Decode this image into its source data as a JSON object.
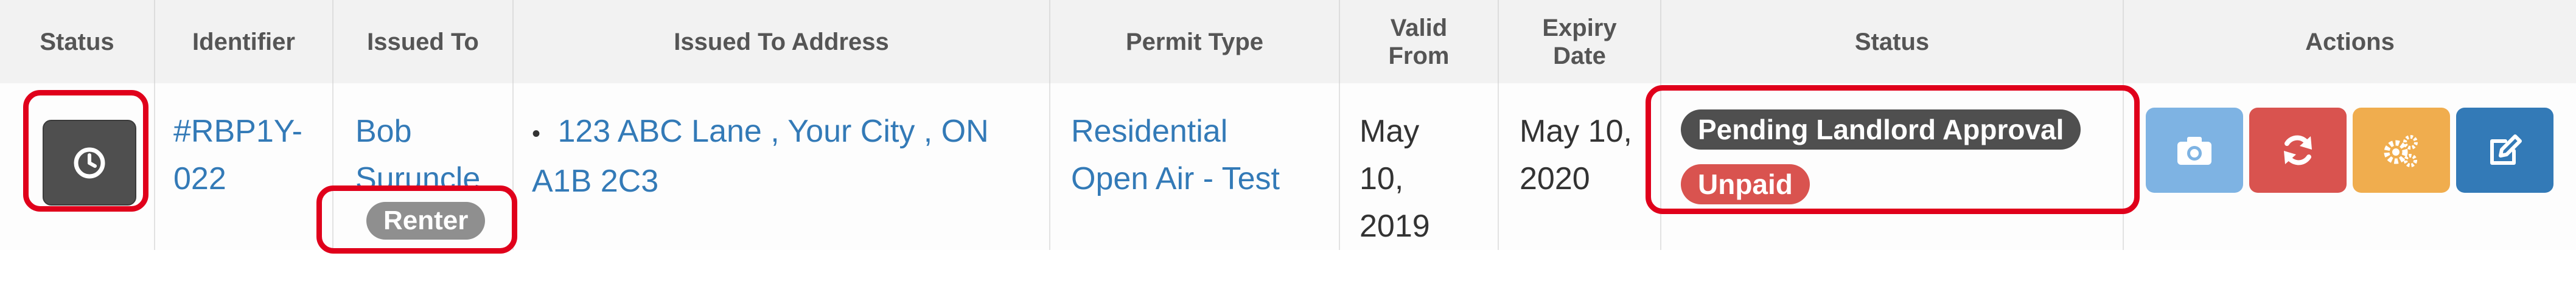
{
  "headers": {
    "status": "Status",
    "identifier": "Identifier",
    "issued_to": "Issued To",
    "issued_to_address": "Issued To Address",
    "permit_type": "Permit Type",
    "valid_from_line1": "Valid",
    "valid_from_line2": "From",
    "expiry_line1": "Expiry",
    "expiry_line2": "Date",
    "status2": "Status",
    "actions": "Actions"
  },
  "row": {
    "identifier_line1": "#RBP1Y-",
    "identifier_line2": "022",
    "issued_to_line1": "Bob",
    "issued_to_line2": "Suruncle",
    "issued_to_badge": "Renter",
    "address_bullet": "•",
    "address_line1": "123 ABC Lane , Your City , ON",
    "address_line2": "A1B 2C3",
    "permit_line1": "Residential",
    "permit_line2": "Open Air - Test",
    "valid_from_line1": "May",
    "valid_from_line2": "10,",
    "valid_from_line3": "2019",
    "expiry_line1": "May 10,",
    "expiry_line2": "2020",
    "status_badge_1": "Pending Landlord Approval",
    "status_badge_2": "Unpaid"
  },
  "icons": {
    "status": "clock-icon",
    "photo": "camera-icon",
    "renew": "refresh-icon",
    "manage": "cogs-icon",
    "edit": "edit-icon"
  },
  "colors": {
    "link": "#337ab7",
    "badge_dark": "#4f4f4f",
    "badge_red": "#d9534f",
    "badge_grey": "#8f8f8f",
    "btn_info": "#7eb3e3",
    "btn_danger": "#d9534f",
    "btn_warning": "#f0ad4e",
    "btn_primary": "#337ab7",
    "highlight": "#e0001b"
  }
}
